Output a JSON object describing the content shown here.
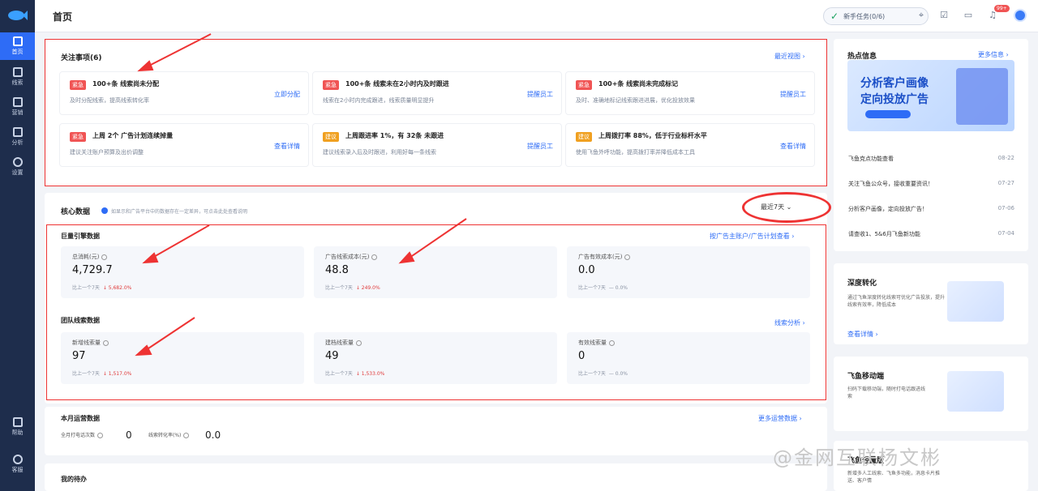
{
  "sidebar": {
    "items": [
      {
        "label": "首页",
        "icon": "home-icon"
      },
      {
        "label": "线索",
        "icon": "phone-icon"
      },
      {
        "label": "营销",
        "icon": "megaphone-icon"
      },
      {
        "label": "分析",
        "icon": "chart-icon"
      },
      {
        "label": "设置",
        "icon": "gear-icon"
      },
      {
        "label": "帮助",
        "icon": "help-book-icon"
      },
      {
        "label": "客服",
        "icon": "headset-icon"
      }
    ]
  },
  "header": {
    "title": "首页",
    "newbie_task": "新手任务(0/6)",
    "notification_count": "99+"
  },
  "focus": {
    "title": "关注事项(6)",
    "view_more": "最近视图 ›",
    "items": [
      {
        "tag": "紧急",
        "tag_color": "#f05454",
        "title": "100+条 线索尚未分配",
        "desc": "及时分配线索，提高线索转化率",
        "action": "立即分配"
      },
      {
        "tag": "紧急",
        "tag_color": "#f05454",
        "title": "100+条 线索未在2小时内及时跟进",
        "desc": "线索在2小时内完成跟进，线索质量明显提升",
        "action": "提醒员工"
      },
      {
        "tag": "紧急",
        "tag_color": "#f05454",
        "title": "100+条 线索尚未完成标记",
        "desc": "及时、准确地标记线索跟进进展，优化投放效果",
        "action": "提醒员工"
      },
      {
        "tag": "紧急",
        "tag_color": "#f05454",
        "title": "上周 2个 广告计划连续掉量",
        "desc": "建议关注账户预算及出价调整",
        "action": "查看详情"
      },
      {
        "tag": "建议",
        "tag_color": "#f0a020",
        "title": "上周跟进率 1%，有 32条 未跟进",
        "desc": "建议线索录入后及时跟进，利用好每一条线索",
        "action": "提醒员工"
      },
      {
        "tag": "建议",
        "tag_color": "#f0a020",
        "title": "上周拨打率 88%，低于行业标杆水平",
        "desc": "使用飞鱼外呼功能，提高拨打率并降低成本工具",
        "action": "查看详情"
      }
    ]
  },
  "core": {
    "title": "核心数据",
    "note": "如显示和广告平台中的数据存在一定差异，可点击此处查看说明",
    "range": "最近7天",
    "ad_group": {
      "title": "巨量引擎数据",
      "link": "按广告主账户/广告计划查看 ›",
      "metrics": [
        {
          "label": "总消耗(元)",
          "value": "4,729.7",
          "cmp_label": "比上一个7天",
          "cmp": "↓ 5,682.0%",
          "cmp_color": "red"
        },
        {
          "label": "广告线索成本(元)",
          "value": "48.8",
          "cmp_label": "比上一个7天",
          "cmp": "↓ 249.0%",
          "cmp_color": "red"
        },
        {
          "label": "广告有效成本(元)",
          "value": "0.0",
          "cmp_label": "比上一个7天",
          "cmp": "— 0.0%",
          "cmp_color": "gray"
        }
      ]
    },
    "team_group": {
      "title": "团队线索数据",
      "link": "线索分析 ›",
      "metrics": [
        {
          "label": "新增线索量",
          "value": "97",
          "cmp_label": "比上一个7天",
          "cmp": "↓ 1,517.0%",
          "cmp_color": "red"
        },
        {
          "label": "建档线索量",
          "value": "49",
          "cmp_label": "比上一个7天",
          "cmp": "↓ 1,533.0%",
          "cmp_color": "red"
        },
        {
          "label": "有效线索量",
          "value": "0",
          "cmp_label": "比上一个7天",
          "cmp": "— 0.0%",
          "cmp_color": "gray"
        }
      ]
    }
  },
  "monthly": {
    "title": "本月运营数据",
    "link": "更多运营数据 ›",
    "items": [
      {
        "label": "全月打电话次数",
        "value": "0"
      },
      {
        "label": "线索转化率(%)",
        "value": "0.0"
      }
    ]
  },
  "todo": {
    "title": "我的待办"
  },
  "hot": {
    "title": "热点信息",
    "more": "更多信息 ›",
    "banner": {
      "line1": "分析客户画像",
      "line2": "定向投放广告"
    },
    "news": [
      {
        "text": "飞鱼克点功能查看",
        "date": "08-22"
      },
      {
        "text": "关注飞鱼公众号，接收重要资讯！",
        "date": "07-27"
      },
      {
        "text": "分析客户画像，定向投放广告！",
        "date": "07-06"
      },
      {
        "text": "请查收1、5&6月飞鱼新功能",
        "date": "07-04"
      }
    ]
  },
  "deep": {
    "title": "深度转化",
    "desc": "通过飞鱼深度转化线索可优化广告投放，提升线索有效率，降低成本",
    "link": "查看详情 ›"
  },
  "mobile": {
    "title": "飞鱼移动端",
    "desc": "扫码下载移动端，随时打电话跟进线索"
  },
  "mobile2": {
    "title": "飞鱼轻量版",
    "desc": "新增多人工线索、飞鱼多功能，消息卡片推送、客户情"
  },
  "watermark": "@金网互联杨文彬"
}
